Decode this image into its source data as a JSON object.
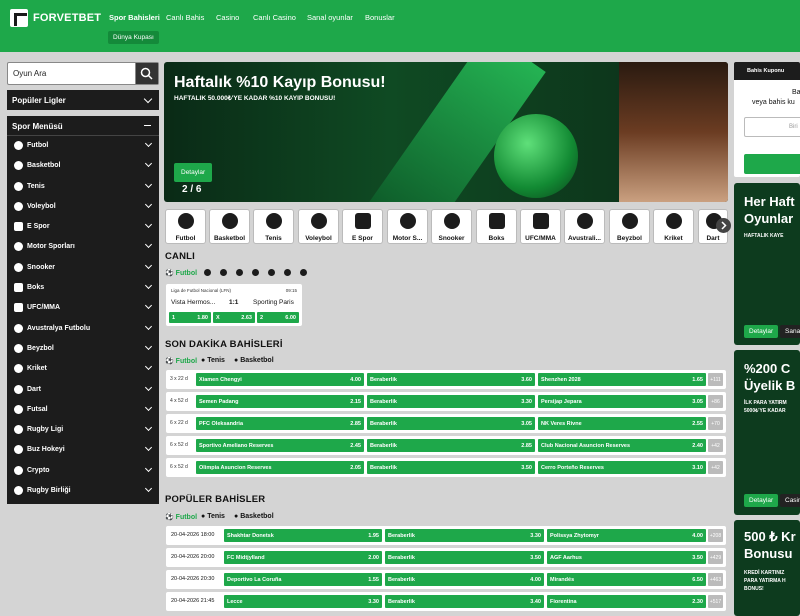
{
  "header": {
    "brand": "FORVETBET",
    "nav": [
      "Spor Bahisleri",
      "Canlı Bahis",
      "Casino",
      "Canlı Casino",
      "Sanal oyunlar",
      "Bonuslar"
    ],
    "sub": "Dünya Kupası"
  },
  "search": {
    "placeholder": "Oyun Ara"
  },
  "sidebar": {
    "popular_title": "Popüler Ligler",
    "menu_title": "Spor Menüsü",
    "sports": [
      "Futbol",
      "Basketbol",
      "Tenis",
      "Voleybol",
      "E Spor",
      "Motor Sporları",
      "Snooker",
      "Boks",
      "UFC/MMA",
      "Avustralya Futbolu",
      "Beyzbol",
      "Kriket",
      "Dart",
      "Futsal",
      "Rugby Ligi",
      "Buz Hokeyi",
      "Crypto",
      "Rugby Birliği"
    ]
  },
  "banner": {
    "title": "Haftalık %10 Kayıp Bonusu!",
    "subtitle": "HAFTALIK 50.000₺'YE KADAR %10 KAYIP BONUSU!",
    "button": "Detaylar",
    "page": "2 / 6"
  },
  "sport_tabs": [
    "Futbol",
    "Basketbol",
    "Tenis",
    "Voleybol",
    "E Spor",
    "Motor S...",
    "Snooker",
    "Boks",
    "UFC/MMA",
    "Avustrali...",
    "Beyzbol",
    "Kriket",
    "Dart"
  ],
  "live": {
    "title": "CANLI",
    "filter": "Futbol",
    "league": "Liga de Futbol Nacional (LFN)",
    "time": "09:15",
    "home": "Vista Hermos...",
    "score": "1:1",
    "away": "Sporting Paris",
    "odds": [
      {
        "l": "1",
        "v": "1.80"
      },
      {
        "l": "X",
        "v": "2.63"
      },
      {
        "l": "2",
        "v": "6.00"
      }
    ]
  },
  "breaking": {
    "title": "SON DAKİKA BAHİSLERİ",
    "filters": [
      "Futbol",
      "Tenis",
      "Basketbol"
    ],
    "rows": [
      {
        "d": "3 x 22 d",
        "h": "Xiamen Chengyi",
        "ho": "4.00",
        "dl": "Beraberlik",
        "do": "3.60",
        "a": "Shenzhen 2028",
        "ao": "1.65",
        "m": "+111"
      },
      {
        "d": "4 x 52 d",
        "h": "Semen Padang",
        "ho": "2.15",
        "dl": "Beraberlik",
        "do": "3.30",
        "a": "Persijap Jepara",
        "ao": "3.05",
        "m": "+86"
      },
      {
        "d": "6 x 22 d",
        "h": "PFC Oleksandria",
        "ho": "2.85",
        "dl": "Beraberlik",
        "do": "3.05",
        "a": "NK Veres Rivne",
        "ao": "2.55",
        "m": "+70"
      },
      {
        "d": "6 x 52 d",
        "h": "Sportivo Ameliano Reserves",
        "ho": "2.45",
        "dl": "Beraberlik",
        "do": "2.85",
        "a": "Club Nacional Asuncion Reserves",
        "ao": "2.40",
        "m": "+42"
      },
      {
        "d": "6 x 52 d",
        "h": "Olimpia Asuncion Reserves",
        "ho": "2.05",
        "dl": "Beraberlik",
        "do": "3.50",
        "a": "Cerro Porteño Reserves",
        "ao": "3.10",
        "m": "+42"
      }
    ]
  },
  "popular": {
    "title": "POPÜLER BAHİSLER",
    "filters": [
      "Futbol",
      "Tenis",
      "Basketbol"
    ],
    "rows": [
      {
        "d": "20-04-2026 18:00",
        "h": "Shakhtar Donetsk",
        "ho": "1.95",
        "dl": "Beraberlik",
        "do": "3.30",
        "a": "Polissya Zhytomyr",
        "ao": "4.00",
        "m": "+208"
      },
      {
        "d": "20-04-2026 20:00",
        "h": "FC Midtjylland",
        "ho": "2.00",
        "dl": "Beraberlik",
        "do": "3.50",
        "a": "AGF Aarhus",
        "ao": "3.50",
        "m": "+429"
      },
      {
        "d": "20-04-2026 20:30",
        "h": "Deportivo La Coruña",
        "ho": "1.55",
        "dl": "Beraberlik",
        "do": "4.00",
        "a": "Mirandés",
        "ao": "6.50",
        "m": "+463"
      },
      {
        "d": "20-04-2026 21:45",
        "h": "Lecce",
        "ho": "3.30",
        "dl": "Beraberlik",
        "do": "3.40",
        "a": "Fiorentina",
        "ao": "2.30",
        "m": "+517"
      }
    ]
  },
  "betslip": {
    "title": "Bahis Kuponu",
    "line1": "Ba",
    "line2": "veya bahis ku",
    "input": "Biri"
  },
  "promos": [
    {
      "title": [
        "Her Haft",
        "Oyunlar"
      ],
      "sub": [
        "HAFTALIK KAYE"
      ],
      "btn1": "Detaylar",
      "btn2": "Sanal"
    },
    {
      "title": [
        "%200 C",
        "Üyelik B"
      ],
      "sub": [
        "İLK PARA YATIRM",
        "5000₺'YE KADAR"
      ],
      "btn1": "Detaylar",
      "btn2": "Casino"
    },
    {
      "title": [
        "500 ₺ Kr",
        "Bonusu"
      ],
      "sub": [
        "KREDİ KARTINIZ",
        "PARA YATIRMA H",
        "BONUS!"
      ]
    }
  ],
  "colors": {
    "brand_green": "#1ea84a",
    "dark": "#1c1c1c",
    "bg": "#d4d4d4"
  }
}
